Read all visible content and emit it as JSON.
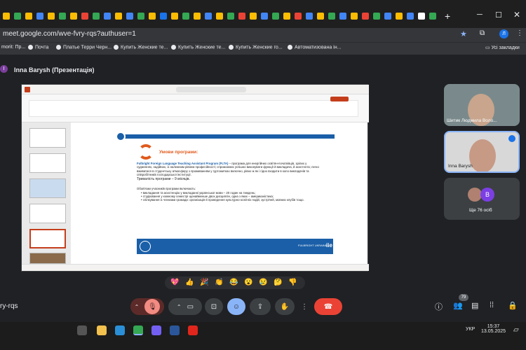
{
  "browser": {
    "url": "meet.google.com/wve-fvry-rqs?authuser=1",
    "bookmarks": [
      "morit: Пр...",
      "Почта",
      "Платье Терри Черн...",
      "Купить Женские те...",
      "Купить Женские те...",
      "Купить Женские го...",
      "Автоматизована ін..."
    ],
    "all_bookmarks": "Усі закладки"
  },
  "meet": {
    "presenter_initial": "I",
    "presenter_title": "Inna Barysh (Презентація)",
    "meeting_code": "ry-rqs",
    "participants_badge": "79"
  },
  "slide": {
    "heading": "Умови програми:",
    "program_name": "Fulbright Foreign Language Teaching Assistant Program (FLTA)",
    "paragraph": " – програма для енергійних освітян-початківців, зрілих у судженнях, надійних, із належним рівнем професійності; спроможних успішно виконувати функції й викладача, й асистента; легко вживатися в студентську атмосферу з проживанням у гуртожитках включно, рівно ж як і гідно входити в коло викладачів та співробітників господарської інституції.",
    "duration": "Тривалість програми – 9 місяців.",
    "duties_title": "Обов'язки учасників програми включають:",
    "duties": [
      "викладання та асистенцію у викладанні української мови – 20 годин на тиждень;",
      "студіювання у кожному семестрі щонайменше двох дисциплін, одна з яких – американістика;",
      "спілкування із членами громади: організація й проведення культурно-освітніх подій, зустрічей, мовних клубів тощо."
    ],
    "footer_logo": "FULBRIGHT UKRAINE",
    "footer_logo2": "iie"
  },
  "tiles": [
    {
      "name": "Шитик Людмила Воло..."
    },
    {
      "name": "Inna Barysh"
    },
    {
      "name": "Ще 76 осіб",
      "avatar_letter": "B"
    }
  ],
  "reactions": [
    "💖",
    "👍",
    "🎉",
    "👏",
    "😂",
    "😮",
    "😢",
    "🤔",
    "👎"
  ],
  "taskbar": {
    "time": "15:37",
    "date": "13.05.2025",
    "lang": "УКР"
  },
  "colors": {
    "accent": "#1a5fa8",
    "leave": "#ea4335",
    "active": "#8ab4f8"
  }
}
